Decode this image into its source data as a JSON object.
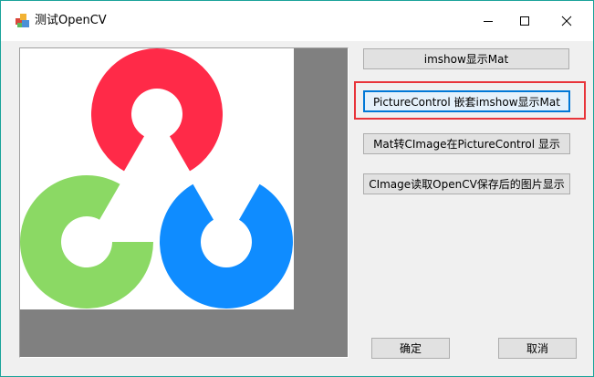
{
  "window": {
    "title": "测试OpenCV",
    "controls": [
      "minimize",
      "maximize",
      "close"
    ]
  },
  "buttons": {
    "imshow": "imshow显示Mat",
    "picture_control": "PictureControl 嵌套imshow显示Mat",
    "mat_to_cimage": "Mat转CImage在PictureControl 显示",
    "cimage_read": "CImage读取OpenCV保存后的图片显示",
    "ok": "确定",
    "cancel": "取消"
  },
  "colors": {
    "red_ring": "#ff2a48",
    "green_ring": "#8bd964",
    "blue_ring": "#0f8cff",
    "highlight_box": "#e8343a"
  },
  "icons": {
    "app": "app-icon",
    "minimize": "minimize-icon",
    "maximize": "maximize-icon",
    "close": "close-icon"
  }
}
